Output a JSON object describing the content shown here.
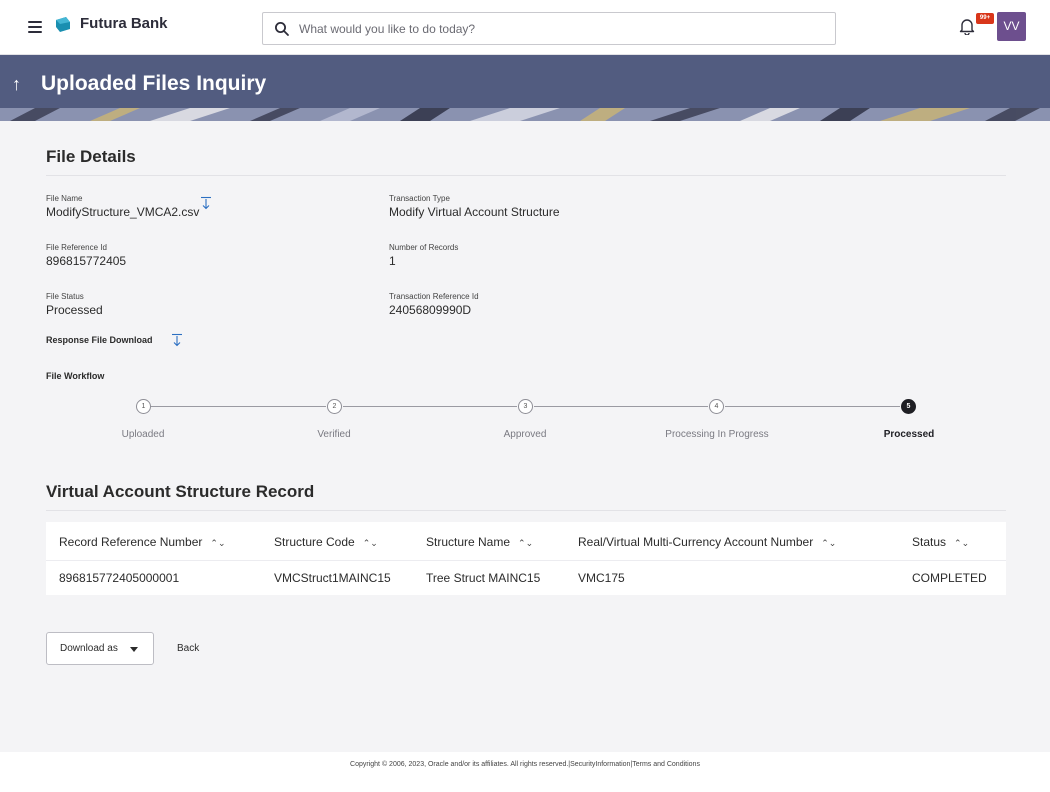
{
  "header": {
    "brand": "Futura Bank",
    "search_placeholder": "What would you like to do today?",
    "notification_badge": "99+",
    "avatar_initials": "VV",
    "icons": {
      "menu": "hamburger-icon",
      "logo": "futura-logo-icon",
      "search": "search-icon",
      "bell": "bell-icon"
    }
  },
  "page": {
    "title": "Uploaded Files Inquiry"
  },
  "file_details": {
    "section_title": "File Details",
    "file_name_label": "File Name",
    "file_name": "ModifyStructure_VMCA2.csv",
    "transaction_type_label": "Transaction Type",
    "transaction_type": "Modify Virtual Account Structure",
    "file_reference_label": "File Reference Id",
    "file_reference": "896815772405",
    "number_of_records_label": "Number of Records",
    "number_of_records": "1",
    "file_status_label": "File Status",
    "file_status": "Processed",
    "transaction_reference_label": "Transaction Reference Id",
    "transaction_reference": "24056809990D",
    "response_file_download": "Response File Download"
  },
  "workflow": {
    "label": "File Workflow",
    "steps": [
      {
        "number": "1",
        "label": "Uploaded",
        "state": "pending"
      },
      {
        "number": "2",
        "label": "Verified",
        "state": "pending"
      },
      {
        "number": "3",
        "label": "Approved",
        "state": "pending"
      },
      {
        "number": "4",
        "label": "Processing In Progress",
        "state": "pending"
      },
      {
        "number": "5",
        "label": "Processed",
        "state": "current"
      }
    ]
  },
  "record_table": {
    "section_title": "Virtual Account Structure Record",
    "columns": [
      "Record Reference Number",
      "Structure Code",
      "Structure Name",
      "Real/Virtual Multi-Currency Account Number",
      "Status"
    ],
    "rows": [
      [
        "896815772405000001",
        "VMCStruct1MAINC15",
        "Tree Struct MAINC15",
        "VMC175",
        "COMPLETED"
      ]
    ]
  },
  "actions": {
    "download_as": "Download as",
    "back": "Back"
  },
  "footer": {
    "copyright": "Copyright © 2006, 2023, Oracle and/or its affiliates. All rights reserved.|SecurityInformation|Terms and Conditions"
  },
  "colors": {
    "banner": "#525c80",
    "avatar": "#6d4f8e",
    "badge": "#d9361a",
    "logo": "#1a8fb0"
  }
}
